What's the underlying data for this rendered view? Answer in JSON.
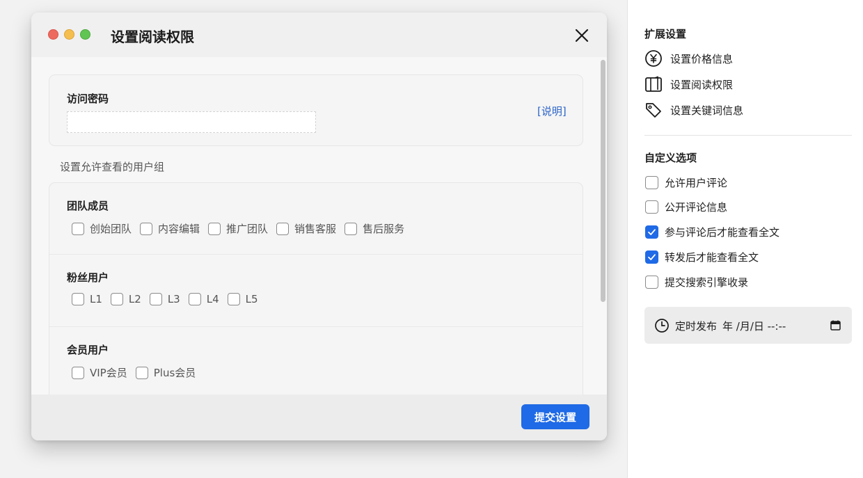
{
  "dialog": {
    "title": "设置阅读权限",
    "password": {
      "label": "访问密码",
      "value": "",
      "placeholder": "",
      "help_link": "[说明]"
    },
    "groups_caption": "设置允许查看的用户组",
    "groups": [
      {
        "title": "团队成员",
        "options": [
          "创始团队",
          "内容编辑",
          "推广团队",
          "销售客服",
          "售后服务"
        ]
      },
      {
        "title": "粉丝用户",
        "options": [
          "L1",
          "L2",
          "L3",
          "L4",
          "L5"
        ]
      },
      {
        "title": "会员用户",
        "options": [
          "VIP会员",
          "Plus会员"
        ]
      }
    ],
    "submit_label": "提交设置"
  },
  "sidebar": {
    "extensions": {
      "title": "扩展设置",
      "items": [
        {
          "label": "设置价格信息",
          "icon": "yen-circle-icon"
        },
        {
          "label": "设置阅读权限",
          "icon": "book-icon"
        },
        {
          "label": "设置关键词信息",
          "icon": "tag-icon"
        }
      ]
    },
    "custom": {
      "title": "自定义选项",
      "items": [
        {
          "label": "允许用户评论",
          "checked": false
        },
        {
          "label": "公开评论信息",
          "checked": false
        },
        {
          "label": "参与评论后才能查看全文",
          "checked": true
        },
        {
          "label": "转发后才能查看全文",
          "checked": true
        },
        {
          "label": "提交搜索引擎收录",
          "checked": false
        }
      ]
    },
    "schedule": {
      "label": "定时发布",
      "value": "年 /月/日 --:--"
    }
  },
  "colors": {
    "accent": "#1f6ae6",
    "link": "#2b63c8"
  }
}
